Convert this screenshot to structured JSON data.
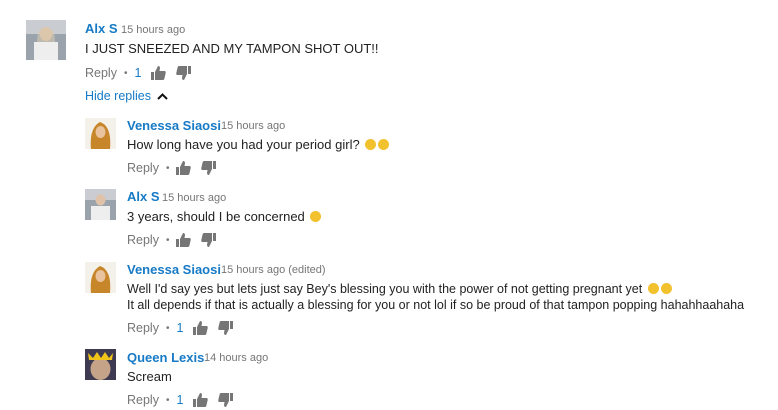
{
  "thread": {
    "hide_replies_label": "Hide replies",
    "comments": [
      {
        "author": "Alx S",
        "time": "15 hours ago",
        "text": "I JUST SNEEZED AND MY TAMPON SHOT OUT!!",
        "reply_label": "Reply",
        "separator": "•",
        "likes": "1"
      },
      {
        "author": "Venessa Siaosi",
        "time": "15 hours ago",
        "text": "How long have you had your period girl?",
        "reply_label": "Reply",
        "separator": "•"
      },
      {
        "author": "Alx S",
        "time": "15 hours ago",
        "text": "3 years, should I be concerned",
        "reply_label": "Reply",
        "separator": "•"
      },
      {
        "author": "Venessa Siaosi",
        "time": "15 hours ago (edited)",
        "text_line1": "Well I'd say yes but lets just say Bey's blessing you with the power of not getting pregnant yet",
        "text_line2": "It all depends if that is actually a blessing for you or not lol if so be proud of that tampon popping hahahhaahaha",
        "reply_label": "Reply",
        "separator": "•",
        "likes": "1"
      },
      {
        "author": "Queen Lexis",
        "time": "14 hours ago",
        "text": "Scream",
        "reply_label": "Reply",
        "separator": "•",
        "likes": "1"
      }
    ]
  }
}
